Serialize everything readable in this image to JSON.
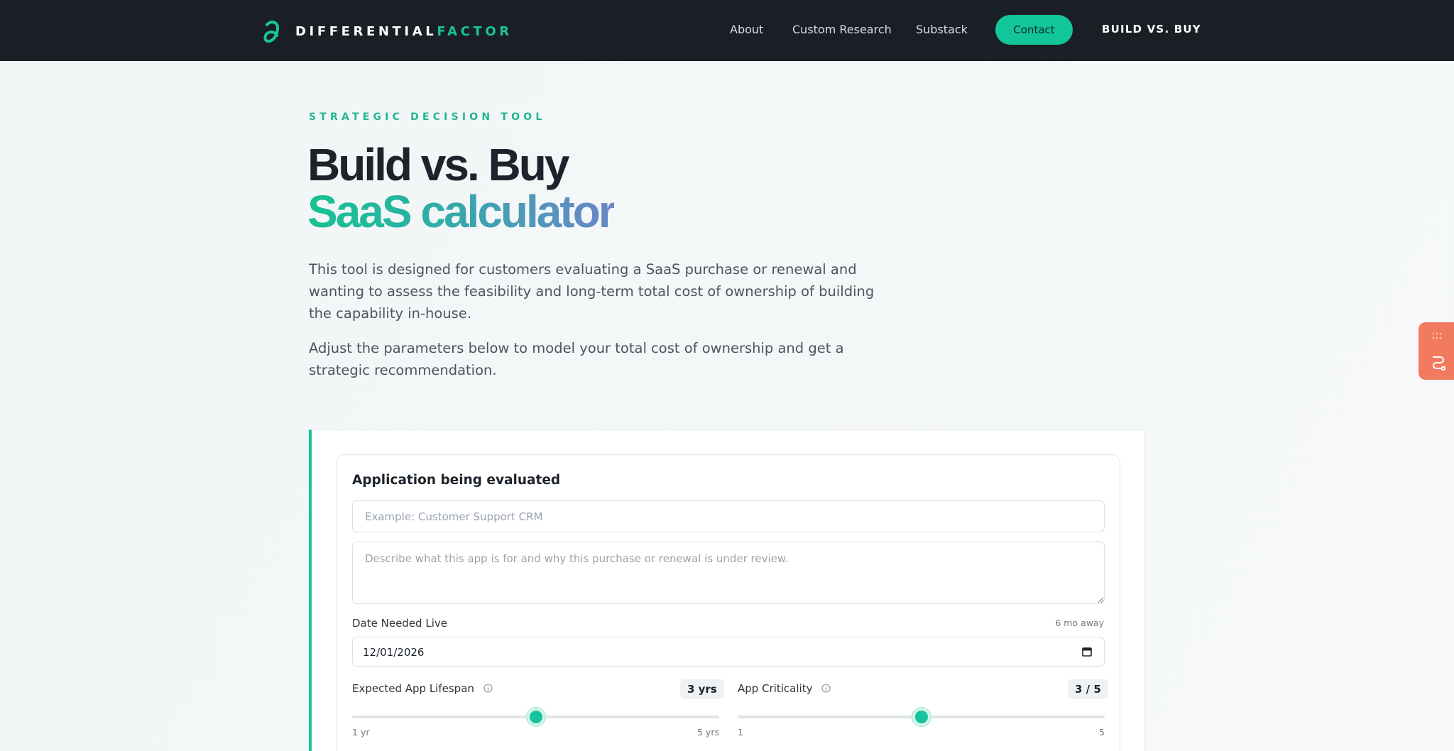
{
  "brand": {
    "name_part1": "DIFFERENTIAL",
    "name_part2": "FACTOR",
    "accent": "#19c39b"
  },
  "nav": {
    "links": [
      "About",
      "Custom Research",
      "Substack"
    ],
    "contact_label": "Contact",
    "right_label": "BUILD VS. BUY"
  },
  "hero": {
    "eyebrow": "STRATEGIC DECISION TOOL",
    "title_line1": "Build vs. Buy",
    "title_line2": "SaaS calculator",
    "intro_p1": "This tool is designed for customers evaluating a SaaS purchase or renewal and wanting to assess the feasibility and long-term total cost of ownership of building the capability in-house.",
    "intro_p2": "Adjust the parameters below to model your total cost of ownership and get a strategic recommendation."
  },
  "form": {
    "section_title": "Application being evaluated",
    "app_name_placeholder": "Example: Customer Support CRM",
    "app_desc_placeholder": "Describe what this app is for and why this purchase or renewal is under review.",
    "date_label": "Date Needed Live",
    "date_hint": "6 mo away",
    "date_value": "12/01/2026",
    "lifespan": {
      "label": "Expected App Lifespan",
      "value_display": "3 yrs",
      "value": 3,
      "min": 1,
      "max": 5,
      "min_label": "1 yr",
      "max_label": "5 yrs"
    },
    "criticality": {
      "label": "App Criticality",
      "value_display": "3 / 5",
      "value": 3,
      "min": 1,
      "max": 5,
      "min_label": "1",
      "max_label": "5"
    }
  },
  "icons": {
    "brand_mark": "partial-derivative-icon",
    "calendar": "calendar-icon",
    "info": "info-icon",
    "floating_tab": "route-icon"
  },
  "colors": {
    "nav_bg": "#1a1f25",
    "primary": "#17c39a",
    "floating_tab": "#f27a5e"
  }
}
